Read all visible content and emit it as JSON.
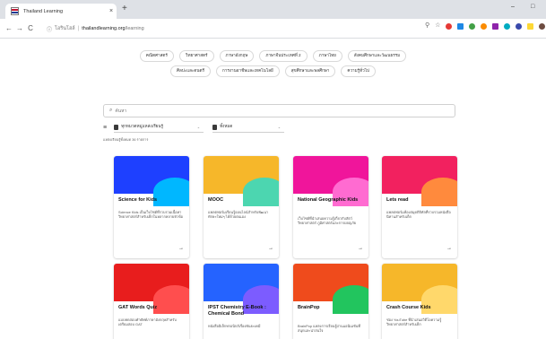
{
  "browser": {
    "tab_title": "Thailand Learning",
    "tab_close": "×",
    "new_tab": "+",
    "minimize": "–",
    "maximize": "□",
    "back": "←",
    "forward": "→",
    "reload": "C",
    "lock": "ⓘ",
    "url_site": "โอรินโฮล์",
    "url_host": "thailandlearning.org",
    "url_path": "/learning",
    "extension_colors": [
      "#e53935",
      "#1e88e5",
      "#43a047",
      "#fb8c00",
      "#8e24aa",
      "#00acc1",
      "#3949ab",
      "#fdd835",
      "#6d4c41"
    ]
  },
  "categories": {
    "row1": [
      "คณิตศาสตร์",
      "วิทยาศาสตร์",
      "ภาษาอังกฤษ",
      "ภาษาจีนประเทศที่ 2",
      "ภาษาไทย",
      "สังคมศึกษาและวัฒนธรรม"
    ],
    "row2": [
      "ศิลปะและดนตรี",
      "การงานอาชีพและเทคโนโลยี",
      "สุขศึกษาและพลศึกษา",
      "ความรู้ทั่วไป"
    ]
  },
  "search": {
    "placeholder": "ค้นหา",
    "icon": "⌕",
    "filter_icon": "≡",
    "dropdown_category": "ทุกหมวดหมู่แหล่งเรียนรู้",
    "dropdown_type": "ทั้งหมด",
    "result_count": "แหล่งเรียนรู้ทั้งหมด 36 รายการ"
  },
  "cards": [
    {
      "title": "Science for Kids",
      "desc": "Science Kids เป็นเว็บไซต์ที่รวบรวมเนื้อหาวิทยาศาสตร์สำหรับเด็กในหลากหลายหัวข้อ",
      "arrow": "→",
      "base": "#1e40ff",
      "accent": "#00b7ff"
    },
    {
      "title": "MOOC",
      "desc": "แพลตฟอร์มเรียนรู้ออนไลน์สำหรับพัฒนาทักษะใหม่ๆ ได้ด้วยตนเอง",
      "arrow": "→",
      "base": "#f6b72a",
      "accent": "#4cd6b0"
    },
    {
      "title": "National Geographic Kids",
      "desc": "เว็บไซต์ที่นำเสนอความรู้เกี่ยวกับสัตว์ วิทยาศาสตร์ ภูมิศาสตร์และการผจญภัย",
      "arrow": "→",
      "base": "#f0159b",
      "accent": "#ff6bd1"
    },
    {
      "title": "Lets read",
      "desc": "แพลตฟอร์มห้องสมุดดิจิทัลที่รวบรวมหนังสือนิทานสำหรับเด็ก",
      "arrow": "→",
      "base": "#f2215f",
      "accent": "#ff8a3d"
    },
    {
      "title": "GAT Words Quiz",
      "desc": "แบบทดสอบคำศัพท์ภาษาอังกฤษสำหรับเตรียมสอบ GAT",
      "arrow": "",
      "base": "#e81d1d",
      "accent": "#ff4e4e"
    },
    {
      "title": "IPST Chemistry E-Book : Chemical Bond",
      "desc": "หนังสืออิเล็กทรอนิกส์เรื่องพันธะเคมี",
      "arrow": "",
      "base": "#2563ff",
      "accent": "#7c5cff"
    },
    {
      "title": "BrainPop",
      "desc": "BrainPop แหล่งการเรียนรู้ผ่านแอนิเมชันที่สนุกและน่าสนใจ",
      "arrow": "",
      "base": "#ef4b1c",
      "accent": "#22c55e"
    },
    {
      "title": "Crash Course Kids",
      "desc": "ช่อง YouTube ที่นำเสนอวิดีโอความรู้วิทยาศาสตร์สำหรับเด็ก",
      "arrow": "",
      "base": "#f6b72a",
      "accent": "#ffd86b"
    }
  ]
}
